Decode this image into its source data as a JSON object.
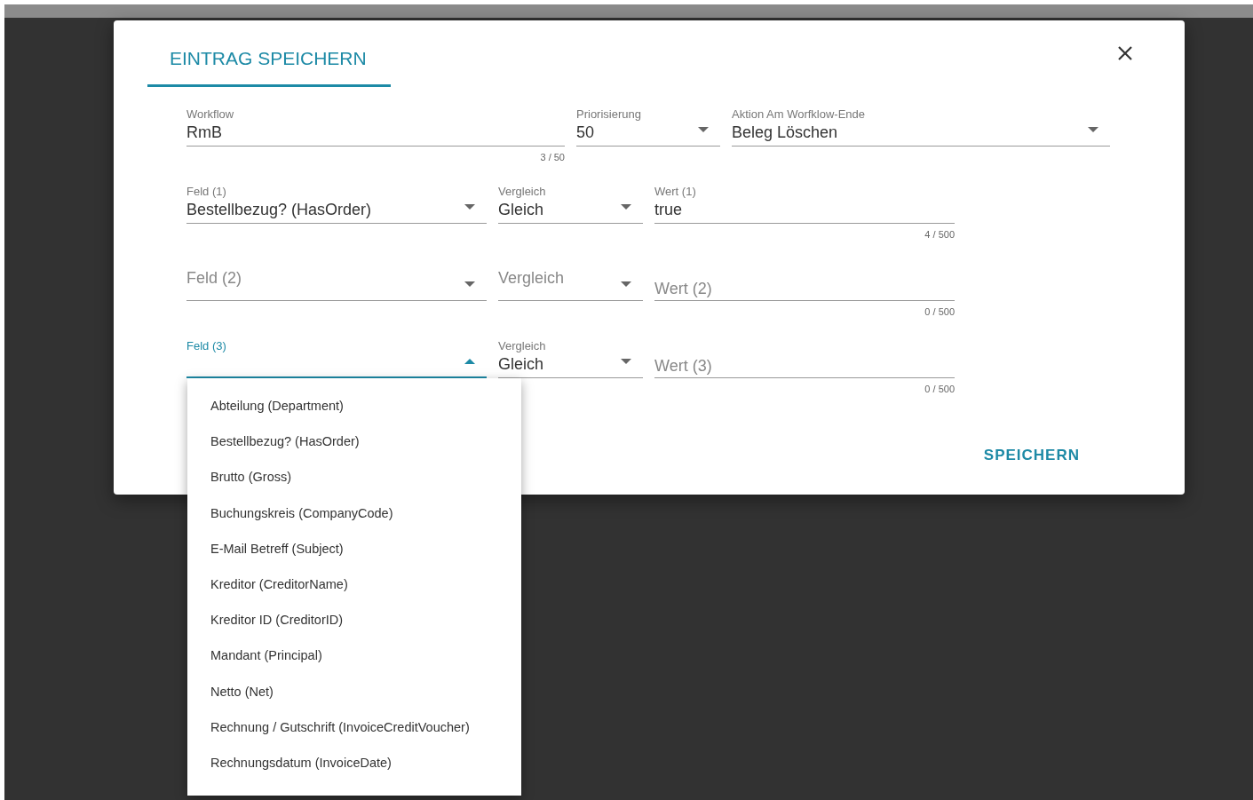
{
  "dialog": {
    "tab": {
      "label": "EINTRAG SPEICHERN",
      "selected": true
    },
    "rows": [
      [
        {
          "kind": "text",
          "label": "Workflow",
          "value": "RmB",
          "counter": "3 / 50",
          "focused": false
        },
        {
          "kind": "select",
          "label": "Priorisierung",
          "value": "50",
          "focused": false,
          "open": false
        },
        {
          "kind": "select",
          "label": "Aktion Am Worfklow-Ende",
          "value": "Beleg Löschen",
          "focused": false,
          "open": false
        }
      ],
      [
        {
          "kind": "select",
          "label": "Feld (1)",
          "value": "Bestellbezug? (HasOrder)",
          "focused": false,
          "open": false
        },
        {
          "kind": "select",
          "label": "Vergleich",
          "value": "Gleich",
          "focused": false,
          "open": false
        },
        {
          "kind": "text",
          "label": "Wert (1)",
          "value": "true",
          "counter": "4 / 500",
          "focused": false
        }
      ],
      [
        {
          "kind": "select",
          "label": "Feld (2)",
          "focused": false,
          "open": false
        },
        {
          "kind": "select",
          "label": "Vergleich",
          "focused": false,
          "open": false
        },
        {
          "kind": "text",
          "label": "Wert (2)",
          "counter": "0 / 500",
          "focused": false
        }
      ],
      [
        {
          "kind": "select",
          "label": "Feld (3)",
          "focused": true,
          "open": true
        },
        {
          "kind": "select",
          "label": "Vergleich",
          "value": "Gleich",
          "focused": false,
          "open": false
        },
        {
          "kind": "text",
          "label": "Wert (3)",
          "counter": "0 / 500",
          "focused": false
        }
      ]
    ],
    "save_button": "SPEICHERN"
  },
  "menu": {
    "items": [
      {
        "label": "Abteilung (Department)",
        "selected": false
      },
      {
        "label": "Bestellbezug? (HasOrder)",
        "selected": false
      },
      {
        "label": "Brutto (Gross)",
        "selected": false
      },
      {
        "label": "Buchungskreis (CompanyCode)",
        "selected": false
      },
      {
        "label": "E-Mail Betreff (Subject)",
        "selected": false
      },
      {
        "label": "Kreditor (CreditorName)",
        "selected": false
      },
      {
        "label": "Kreditor ID (CreditorID)",
        "selected": false
      },
      {
        "label": "Mandant (Principal)",
        "selected": false
      },
      {
        "label": "Netto (Net)",
        "selected": false
      },
      {
        "label": "Rechnung / Gutschrift (InvoiceCreditVoucher)",
        "selected": false
      },
      {
        "label": "Rechnungsdatum (InvoiceDate)",
        "selected": false
      }
    ]
  }
}
